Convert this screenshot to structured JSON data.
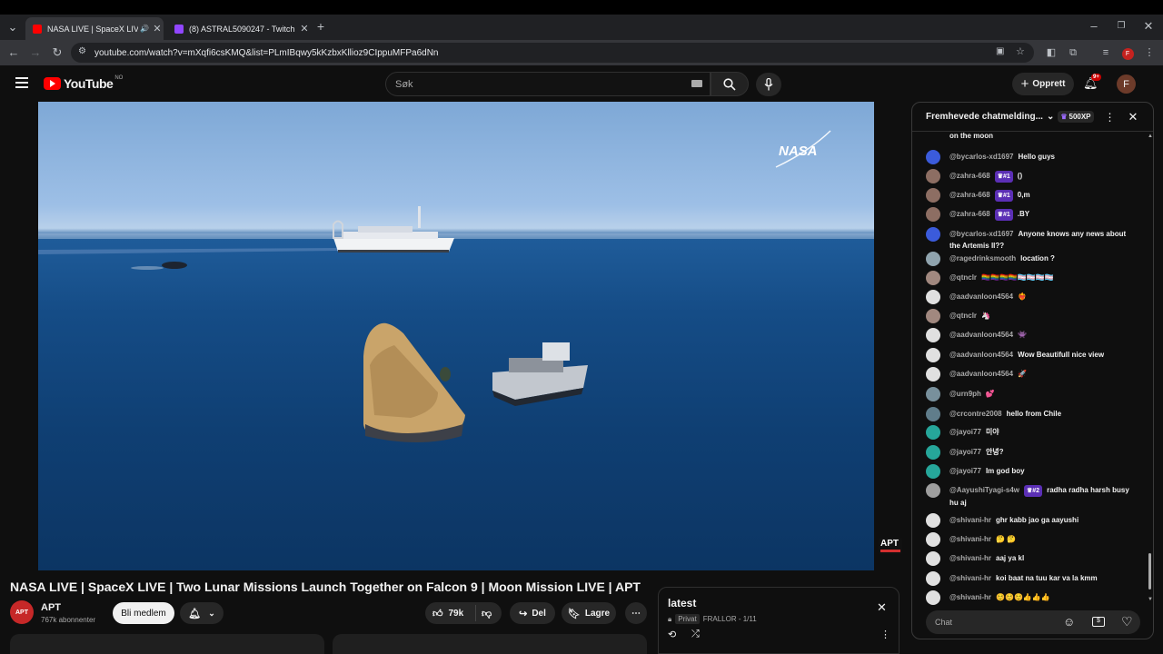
{
  "browser": {
    "tabs": [
      {
        "title": "NASA LIVE | SpaceX LIVE | T",
        "favicon_color": "#ff0000"
      },
      {
        "title": "(8) ASTRAL5090247 - Twitch",
        "favicon_color": "#9146ff"
      }
    ],
    "url": "youtube.com/watch?v=mXqfi6csKMQ&list=PLmIBqwy5kKzbxKllioz9CIppuMFPa6dNn"
  },
  "youtube": {
    "logo_text": "YouTube",
    "region": "NO",
    "search_placeholder": "Søk",
    "create_label": "Opprett",
    "notification_count": "9+",
    "avatar_letter": "F"
  },
  "video": {
    "watermark": "NASA",
    "corner_logo": "APT",
    "title": "NASA LIVE | SpaceX LIVE | Two Lunar Missions Launch Together on Falcon 9 | Moon Mission LIVE | APT"
  },
  "channel": {
    "avatar_text": "APT",
    "name": "APT",
    "subscribers": "767k abonnenter",
    "join_label": "Bli medlem"
  },
  "actions": {
    "like_count": "79k",
    "share_label": "Del",
    "save_label": "Lagre"
  },
  "playlist": {
    "title": "latest",
    "privacy": "Privat",
    "owner_progress": "FRALLOR - 1/11"
  },
  "chat": {
    "header_title": "Fremhevede chatmelding...",
    "xp_label": "500XP",
    "input_placeholder": "Chat",
    "partial_text": "on the moon",
    "messages": [
      {
        "author": "@bycarlos-xd1697",
        "badge": "",
        "text": "Hello guys",
        "avatar_color": "#3b5bdb"
      },
      {
        "author": "@zahra-668",
        "badge": "#1",
        "text": "()",
        "avatar_color": "#8d6e63"
      },
      {
        "author": "@zahra-668",
        "badge": "#1",
        "text": "0,m",
        "avatar_color": "#8d6e63"
      },
      {
        "author": "@zahra-668",
        "badge": "#1",
        "text": ".BY",
        "avatar_color": "#8d6e63"
      },
      {
        "author": "@bycarlos-xd1697",
        "badge": "",
        "text": "Anyone knows any news about the Artemis II??",
        "avatar_color": "#3b5bdb"
      },
      {
        "author": "@ragedrinksmooth",
        "badge": "",
        "text": "location ?",
        "avatar_color": "#90a4ae"
      },
      {
        "author": "@qtnclr",
        "badge": "",
        "text": "🏳️‍🌈🏳️‍🌈🏳️‍🌈🏳️‍🌈🏳️‍⚧️🏳️‍⚧️🏳️‍⚧️🏳️‍⚧️",
        "avatar_color": "#a1887f"
      },
      {
        "author": "@aadvanloon4564",
        "badge": "",
        "text": "❤️‍🔥",
        "avatar_color": "#e0e0e0"
      },
      {
        "author": "@qtnclr",
        "badge": "",
        "text": "🦄",
        "avatar_color": "#a1887f"
      },
      {
        "author": "@aadvanloon4564",
        "badge": "",
        "text": "👾",
        "avatar_color": "#e0e0e0"
      },
      {
        "author": "@aadvanloon4564",
        "badge": "",
        "text": "Wow Beautifull nice view",
        "avatar_color": "#e0e0e0"
      },
      {
        "author": "@aadvanloon4564",
        "badge": "",
        "text": "🚀",
        "avatar_color": "#e0e0e0"
      },
      {
        "author": "@urn9ph",
        "badge": "",
        "text": "💕",
        "avatar_color": "#78909c"
      },
      {
        "author": "@crcontre2008",
        "badge": "",
        "text": "hello from Chile",
        "avatar_color": "#607d8b"
      },
      {
        "author": "@jayoi77",
        "badge": "",
        "text": "미야",
        "avatar_color": "#26a69a"
      },
      {
        "author": "@jayoi77",
        "badge": "",
        "text": "안녕?",
        "avatar_color": "#26a69a"
      },
      {
        "author": "@jayoi77",
        "badge": "",
        "text": "Im god boy",
        "avatar_color": "#26a69a"
      },
      {
        "author": "@AayushiTyagi-s4w",
        "badge": "#2",
        "text": "radha radha harsh busy hu aj",
        "avatar_color": "#9e9e9e"
      },
      {
        "author": "@shivani-hr",
        "badge": "",
        "text": "ghr kabb jao ga aayushi",
        "avatar_color": "#e0e0e0"
      },
      {
        "author": "@shivani-hr",
        "badge": "",
        "text": "🤔 🤔",
        "avatar_color": "#e0e0e0"
      },
      {
        "author": "@shivani-hr",
        "badge": "",
        "text": "aaj ya kl",
        "avatar_color": "#e0e0e0"
      },
      {
        "author": "@shivani-hr",
        "badge": "",
        "text": "koi baat na tuu kar va la kmm",
        "avatar_color": "#e0e0e0"
      },
      {
        "author": "@shivani-hr",
        "badge": "",
        "text": "☺️☺️☺️👍👍👍",
        "avatar_color": "#e0e0e0"
      }
    ]
  }
}
